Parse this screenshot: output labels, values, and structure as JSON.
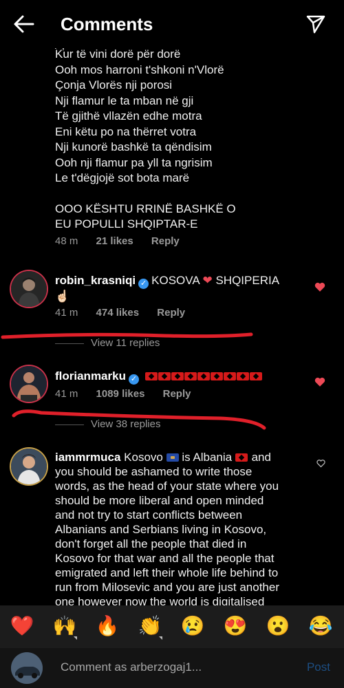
{
  "header": {
    "title": "Comments"
  },
  "lyric_comment": {
    "cut_text": "/  ,",
    "lines": [
      "Kur të vini dorë për dorë",
      "Ooh mos harroni t'shkoni n'Vlorë",
      "Çonja Vlorës nji porosi",
      "Nji flamur le ta mban në gji",
      "Të gjithë vllazën edhe motra",
      "Eni këtu po na thërret votra",
      "Nji kunorë bashkë ta qëndisim",
      "Ooh nji flamur pa yll ta ngrisim",
      "Le t'dëgjojë sot bota marë"
    ],
    "closing_lines": [
      "OOO KËSHTU RRINË BASHKË O",
      "EU POPULLI SHQIPTAR-E"
    ],
    "time": "48 m",
    "likes": "21 likes",
    "reply": "Reply"
  },
  "comments": [
    {
      "username": "robin_krasniqi",
      "text_before": "KOSOVA",
      "text_after": "SHQIPERIA",
      "emoji_line2": "☝🏻",
      "time": "41 m",
      "likes": "474 likes",
      "reply": "Reply",
      "view_replies": "View 11 replies",
      "liked": true
    },
    {
      "username": "florianmarku",
      "flag_count": 9,
      "time": "41 m",
      "likes": "1089 likes",
      "reply": "Reply",
      "view_replies": "View 38 replies",
      "liked": true
    },
    {
      "username": "iammrmuca",
      "word_kosovo": "Kosovo",
      "word_is_albania": "is Albania",
      "word_and": "and",
      "body_lines": [
        "you should be ashamed to write those",
        "words, as the head of your state where you",
        "should be more liberal and open minded",
        "and not try to start conflicts between",
        "Albanians and Serbians living in Kosovo,",
        "don't forget all the people that died in",
        "Kosovo for that war and all the people that",
        "emigrated and left their whole life behind to",
        "run from Milosevic and you are just another",
        "one however now the world is digitalised"
      ],
      "liked": false
    }
  ],
  "emoji_bar": [
    "❤️",
    "🙌",
    "🔥",
    "👏",
    "😢",
    "😍",
    "😮",
    "😂"
  ],
  "composer": {
    "placeholder": "Comment as arberzogaj1...",
    "post_label": "Post"
  },
  "colors": {
    "background": "#000000",
    "like_red": "#ed4956",
    "verified_blue": "#3897f0",
    "annotation_red": "#e0202a",
    "post_disabled": "#1d4f84"
  }
}
